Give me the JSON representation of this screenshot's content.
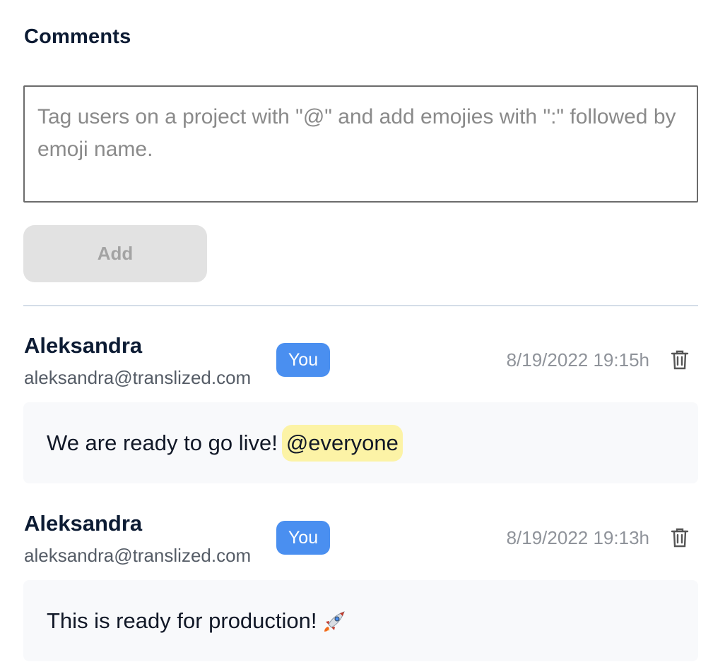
{
  "section": {
    "title": "Comments"
  },
  "comment_form": {
    "placeholder": "Tag users on a project with \"@\" and add emojies with \":\" followed by emoji name.",
    "value": "",
    "add_label": "Add"
  },
  "comments": [
    {
      "author": "Aleksandra",
      "email": "aleksandra@translized.com",
      "badge": "You",
      "timestamp": "8/19/2022 19:15h",
      "text": "We are ready to go live!",
      "mention": "@everyone"
    },
    {
      "author": "Aleksandra",
      "email": "aleksandra@translized.com",
      "badge": "You",
      "timestamp": "8/19/2022 19:13h",
      "text": "This is ready for production!",
      "emoji": "rocket"
    }
  ],
  "colors": {
    "badge": "#4a8ff0",
    "mention_highlight": "#fcf3a6",
    "add_button_disabled": "#e2e2e2",
    "comment_background": "#f8f9fb"
  }
}
